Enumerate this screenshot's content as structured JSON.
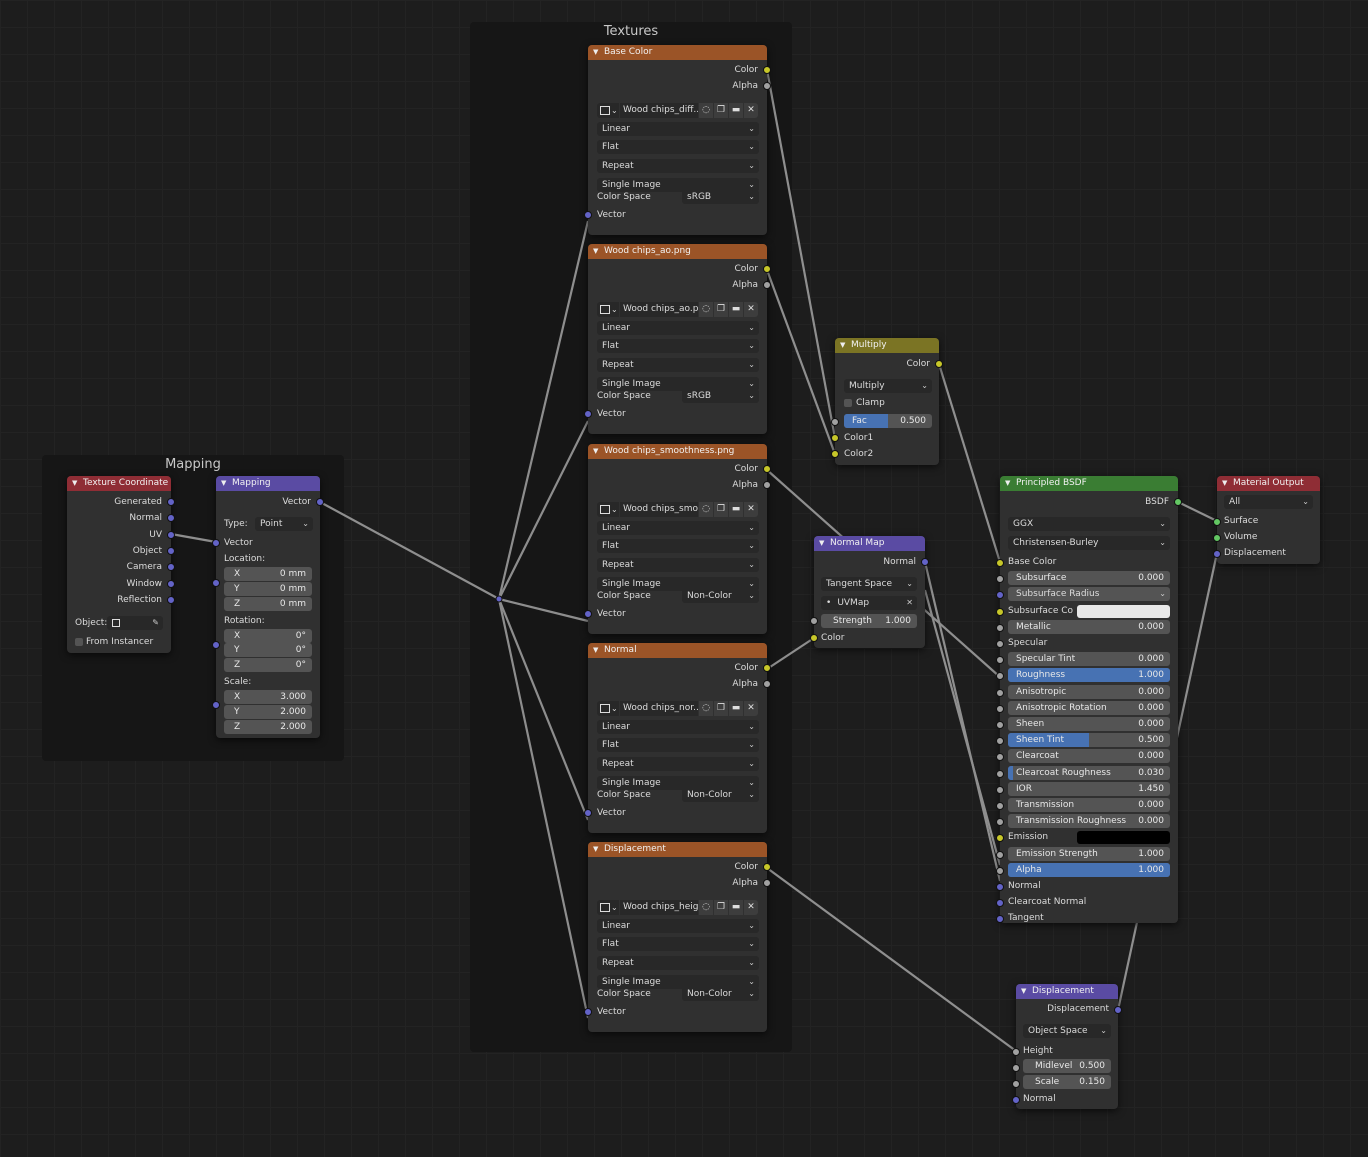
{
  "frames": {
    "textures": "Textures",
    "mapping": "Mapping"
  },
  "common": {
    "color": "Color",
    "alpha": "Alpha",
    "vector": "Vector",
    "normal": "Normal",
    "linear": "Linear",
    "flat": "Flat",
    "repeat": "Repeat",
    "single_image": "Single Image",
    "color_space": "Color Space",
    "srgb": "sRGB",
    "non_color": "Non-Color",
    "x": "X",
    "y": "Y",
    "z": "Z"
  },
  "tex_nodes": [
    {
      "title": "Base Color",
      "image": "Wood chips_diff...",
      "colorspace": "sRGB"
    },
    {
      "title": "Wood chips_ao.png",
      "image": "Wood chips_ao.p...",
      "colorspace": "sRGB"
    },
    {
      "title": "Wood chips_smoothness.png",
      "image": "Wood chips_smo...",
      "colorspace": "Non-Color"
    },
    {
      "title": "Normal",
      "image": "Wood chips_nor...",
      "colorspace": "Non-Color"
    },
    {
      "title": "Displacement",
      "image": "Wood chips_heig...",
      "colorspace": "Non-Color"
    }
  ],
  "texcoord": {
    "title": "Texture Coordinate",
    "outputs": [
      "Generated",
      "Normal",
      "UV",
      "Object",
      "Camera",
      "Window",
      "Reflection"
    ],
    "object_label": "Object:",
    "from_instancer": "From Instancer"
  },
  "mapping": {
    "title": "Mapping",
    "out": "Vector",
    "type_label": "Type:",
    "type_value": "Point",
    "vector_in": "Vector",
    "location_label": "Location:",
    "location": [
      "0 mm",
      "0 mm",
      "0 mm"
    ],
    "rotation_label": "Rotation:",
    "rotation": [
      "0°",
      "0°",
      "0°"
    ],
    "scale_label": "Scale:",
    "scale": [
      "3.000",
      "2.000",
      "2.000"
    ]
  },
  "multiply": {
    "title": "Multiply",
    "out": "Color",
    "mode": "Multiply",
    "clamp": "Clamp",
    "fac_label": "Fac",
    "fac_value": "0.500",
    "fac_fraction": 0.5,
    "color1": "Color1",
    "color2": "Color2"
  },
  "normalmap": {
    "title": "Normal Map",
    "out": "Normal",
    "space": "Tangent Space",
    "uvmap": "UVMap",
    "strength_label": "Strength",
    "strength_value": "1.000",
    "color_in": "Color"
  },
  "bsdf": {
    "title": "Principled BSDF",
    "out": "BSDF",
    "distribution": "GGX",
    "subsurface_method": "Christensen-Burley",
    "rows": [
      {
        "label": "Base Color",
        "type": "socket",
        "sock": "s-y"
      },
      {
        "label": "Subsurface",
        "value": "0.000",
        "fill": 0,
        "sock": "s-g"
      },
      {
        "label": "Subsurface Radius",
        "type": "dropdown",
        "sock": "s-b"
      },
      {
        "label": "Subsurface Co",
        "type": "swatch",
        "color": "#e8e8e8",
        "sock": "s-y"
      },
      {
        "label": "Metallic",
        "value": "0.000",
        "fill": 0,
        "sock": "s-g"
      },
      {
        "label": "Specular",
        "type": "socket",
        "sock": "s-g"
      },
      {
        "label": "Specular Tint",
        "value": "0.000",
        "fill": 0,
        "sock": "s-g"
      },
      {
        "label": "Roughness",
        "value": "1.000",
        "fill": 1,
        "sock": "s-g"
      },
      {
        "label": "Anisotropic",
        "value": "0.000",
        "fill": 0,
        "sock": "s-g"
      },
      {
        "label": "Anisotropic Rotation",
        "value": "0.000",
        "fill": 0,
        "sock": "s-g"
      },
      {
        "label": "Sheen",
        "value": "0.000",
        "fill": 0,
        "sock": "s-g"
      },
      {
        "label": "Sheen Tint",
        "value": "0.500",
        "fill": 0.5,
        "sock": "s-g"
      },
      {
        "label": "Clearcoat",
        "value": "0.000",
        "fill": 0,
        "sock": "s-g"
      },
      {
        "label": "Clearcoat Roughness",
        "value": "0.030",
        "fill": 0.03,
        "sock": "s-g"
      },
      {
        "label": "IOR",
        "value": "1.450",
        "fill": 0,
        "sock": "s-g"
      },
      {
        "label": "Transmission",
        "value": "0.000",
        "fill": 0,
        "sock": "s-g"
      },
      {
        "label": "Transmission Roughness",
        "value": "0.000",
        "fill": 0,
        "sock": "s-g"
      },
      {
        "label": "Emission",
        "type": "swatch",
        "color": "#000000",
        "sock": "s-y"
      },
      {
        "label": "Emission Strength",
        "value": "1.000",
        "fill": 0,
        "sock": "s-g"
      },
      {
        "label": "Alpha",
        "value": "1.000",
        "fill": 1,
        "sock": "s-g"
      },
      {
        "label": "Normal",
        "type": "socket",
        "sock": "s-b"
      },
      {
        "label": "Clearcoat Normal",
        "type": "socket",
        "sock": "s-b"
      },
      {
        "label": "Tangent",
        "type": "socket",
        "sock": "s-b"
      }
    ]
  },
  "output": {
    "title": "Material Output",
    "target": "All",
    "inputs": [
      "Surface",
      "Volume",
      "Displacement"
    ]
  },
  "displacement": {
    "title": "Displacement",
    "out": "Displacement",
    "space": "Object Space",
    "height": "Height",
    "midlevel_label": "Midlevel",
    "midlevel_value": "0.500",
    "scale_label": "Scale",
    "scale_value": "0.150",
    "normal": "Normal"
  }
}
